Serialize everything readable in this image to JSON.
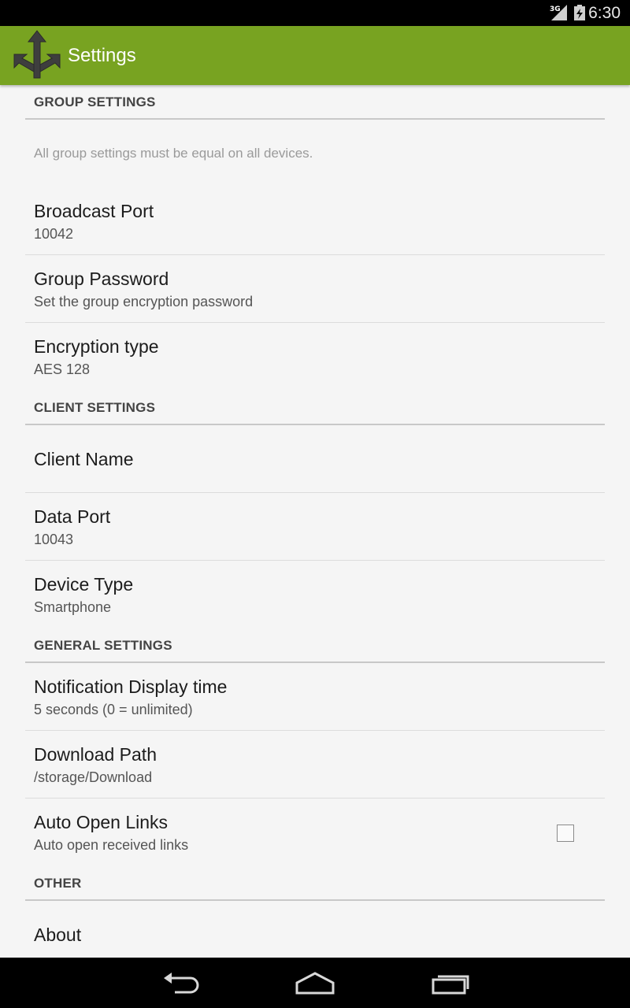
{
  "status_bar": {
    "network": "3G",
    "time": "6:30"
  },
  "action_bar": {
    "title": "Settings",
    "app_icon": "arrows-split-icon",
    "accent_color": "#78a321"
  },
  "sections": {
    "group": {
      "header": "GROUP SETTINGS",
      "note": "All group settings must be equal on all devices.",
      "broadcast_port": {
        "title": "Broadcast Port",
        "summary": "10042"
      },
      "group_password": {
        "title": "Group Password",
        "summary": "Set the group encryption password"
      },
      "encryption_type": {
        "title": "Encryption type",
        "summary": "AES 128"
      }
    },
    "client": {
      "header": "CLIENT SETTINGS",
      "client_name": {
        "title": "Client Name"
      },
      "data_port": {
        "title": "Data Port",
        "summary": "10043"
      },
      "device_type": {
        "title": "Device Type",
        "summary": "Smartphone"
      }
    },
    "general": {
      "header": "GENERAL SETTINGS",
      "notification_time": {
        "title": "Notification Display time",
        "summary": "5 seconds (0 = unlimited)"
      },
      "download_path": {
        "title": "Download Path",
        "summary": "/storage/Download"
      },
      "auto_open_links": {
        "title": "Auto Open Links",
        "summary": "Auto open received links",
        "checked": false
      }
    },
    "other": {
      "header": "OTHER",
      "about": {
        "title": "About"
      }
    }
  },
  "nav_bar": {
    "buttons": [
      "back-icon",
      "home-icon",
      "recent-apps-icon"
    ]
  }
}
